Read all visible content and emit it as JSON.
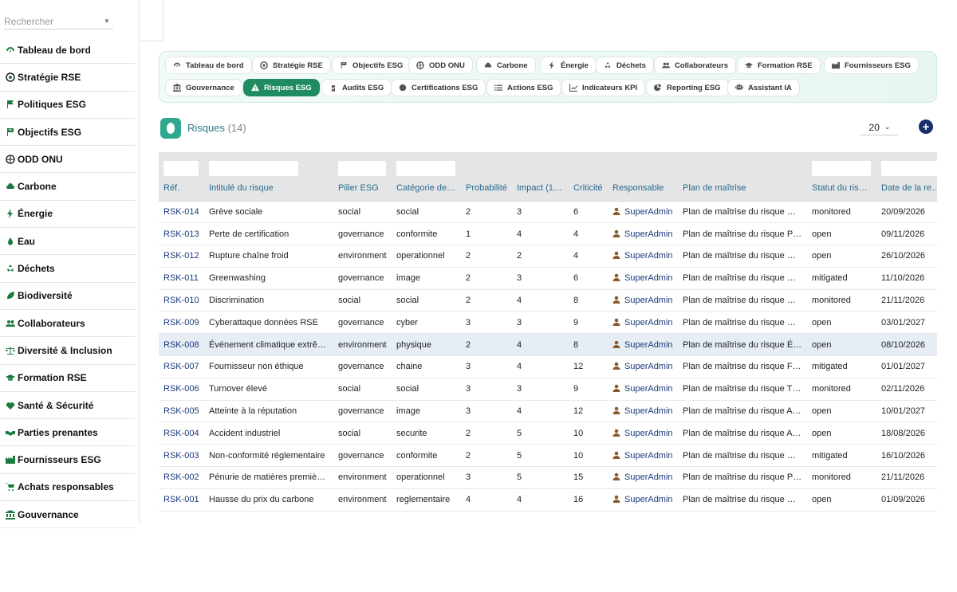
{
  "search": {
    "placeholder": "Rechercher"
  },
  "sidebar": {
    "items": [
      {
        "label": "Tableau de bord",
        "icon": "dashboard-icon"
      },
      {
        "label": "Stratégie RSE",
        "icon": "target-icon"
      },
      {
        "label": "Politiques ESG",
        "icon": "flag-icon"
      },
      {
        "label": "Objectifs ESG",
        "icon": "flag-checkered-icon"
      },
      {
        "label": "ODD ONU",
        "icon": "globe-icon"
      },
      {
        "label": "Carbone",
        "icon": "cloud-icon"
      },
      {
        "label": "Énergie",
        "icon": "bolt-icon"
      },
      {
        "label": "Eau",
        "icon": "water-drop-icon"
      },
      {
        "label": "Déchets",
        "icon": "recycle-icon"
      },
      {
        "label": "Biodiversité",
        "icon": "leaf-icon"
      },
      {
        "label": "Collaborateurs",
        "icon": "users-icon"
      },
      {
        "label": "Diversité & Inclusion",
        "icon": "balance-icon"
      },
      {
        "label": "Formation RSE",
        "icon": "graduation-cap-icon"
      },
      {
        "label": "Santé & Sécurité",
        "icon": "heart-pulse-icon"
      },
      {
        "label": "Parties prenantes",
        "icon": "handshake-icon"
      },
      {
        "label": "Fournisseurs ESG",
        "icon": "industry-icon"
      },
      {
        "label": "Achats responsables",
        "icon": "cart-icon"
      },
      {
        "label": "Gouvernance",
        "icon": "landmark-icon"
      }
    ]
  },
  "tabs": {
    "row1": [
      {
        "label": "Tableau de bord",
        "icon": "dashboard-icon"
      },
      {
        "label": "Stratégie RSE",
        "icon": "target-icon"
      },
      {
        "label": "Objectifs ESG",
        "icon": "flag-checkered-icon"
      },
      {
        "label": "ODD ONU",
        "icon": "globe-icon"
      },
      {
        "label": "Carbone",
        "icon": "cloud-icon"
      },
      {
        "label": "Énergie",
        "icon": "bolt-icon"
      },
      {
        "label": "Déchets",
        "icon": "recycle-icon"
      },
      {
        "label": "Collaborateurs",
        "icon": "users-icon"
      },
      {
        "label": "Formation RSE",
        "icon": "graduation-cap-icon"
      },
      {
        "label": "Fournisseurs ESG",
        "icon": "industry-icon"
      }
    ],
    "row2": [
      {
        "label": "Gouvernance",
        "icon": "landmark-icon"
      },
      {
        "label": "Risques ESG",
        "icon": "warning-icon",
        "active": true
      },
      {
        "label": "Audits ESG",
        "icon": "clipboard-check-icon"
      },
      {
        "label": "Certifications ESG",
        "icon": "certificate-icon"
      },
      {
        "label": "Actions ESG",
        "icon": "list-icon"
      },
      {
        "label": "Indicateurs KPI",
        "icon": "chart-line-icon"
      },
      {
        "label": "Reporting ESG",
        "icon": "chart-pie-icon"
      },
      {
        "label": "Assistant IA",
        "icon": "robot-icon"
      }
    ]
  },
  "list": {
    "title": "Risques",
    "count": "(14)",
    "page_size": "20",
    "add_label": "+"
  },
  "table": {
    "columns": [
      "Réf.",
      "Intitulé du risque",
      "Pilier ESG",
      "Catégorie de…",
      "Probabilité",
      "Impact (1-5)",
      "Criticité",
      "Responsable",
      "Plan de maîtrise",
      "Statut du ris…",
      "Date de la re…"
    ],
    "rows": [
      [
        "RSK-014",
        "Grève sociale",
        "social",
        "social",
        "2",
        "3",
        "6",
        "SuperAdmin",
        "Plan de maîtrise du risque …",
        "monitored",
        "20/09/2026"
      ],
      [
        "RSK-013",
        "Perte de certification",
        "governance",
        "conformite",
        "1",
        "4",
        "4",
        "SuperAdmin",
        "Plan de maîtrise du risque P…",
        "open",
        "09/11/2026"
      ],
      [
        "RSK-012",
        "Rupture chaîne froid",
        "environment",
        "operationnel",
        "2",
        "2",
        "4",
        "SuperAdmin",
        "Plan de maîtrise du risque …",
        "open",
        "26/10/2026"
      ],
      [
        "RSK-011",
        "Greenwashing",
        "governance",
        "image",
        "2",
        "3",
        "6",
        "SuperAdmin",
        "Plan de maîtrise du risque …",
        "mitigated",
        "11/10/2026"
      ],
      [
        "RSK-010",
        "Discrimination",
        "social",
        "social",
        "2",
        "4",
        "8",
        "SuperAdmin",
        "Plan de maîtrise du risque …",
        "monitored",
        "21/11/2026"
      ],
      [
        "RSK-009",
        "Cyberattaque données RSE",
        "governance",
        "cyber",
        "3",
        "3",
        "9",
        "SuperAdmin",
        "Plan de maîtrise du risque …",
        "open",
        "03/01/2027"
      ],
      [
        "RSK-008",
        "Événement climatique extrê…",
        "environment",
        "physique",
        "2",
        "4",
        "8",
        "SuperAdmin",
        "Plan de maîtrise du risque É…",
        "open",
        "08/10/2026"
      ],
      [
        "RSK-007",
        "Fournisseur non éthique",
        "governance",
        "chaine",
        "3",
        "4",
        "12",
        "SuperAdmin",
        "Plan de maîtrise du risque F…",
        "mitigated",
        "01/01/2027"
      ],
      [
        "RSK-006",
        "Turnover élevé",
        "social",
        "social",
        "3",
        "3",
        "9",
        "SuperAdmin",
        "Plan de maîtrise du risque T…",
        "monitored",
        "02/11/2026"
      ],
      [
        "RSK-005",
        "Atteinte à la réputation",
        "governance",
        "image",
        "3",
        "4",
        "12",
        "SuperAdmin",
        "Plan de maîtrise du risque A…",
        "open",
        "10/01/2027"
      ],
      [
        "RSK-004",
        "Accident industriel",
        "social",
        "securite",
        "2",
        "5",
        "10",
        "SuperAdmin",
        "Plan de maîtrise du risque A…",
        "open",
        "18/08/2026"
      ],
      [
        "RSK-003",
        "Non-conformité réglementaire",
        "governance",
        "conformite",
        "2",
        "5",
        "10",
        "SuperAdmin",
        "Plan de maîtrise du risque …",
        "mitigated",
        "16/10/2026"
      ],
      [
        "RSK-002",
        "Pénurie de matières premiè…",
        "environment",
        "operationnel",
        "3",
        "5",
        "15",
        "SuperAdmin",
        "Plan de maîtrise du risque P…",
        "monitored",
        "21/11/2026"
      ],
      [
        "RSK-001",
        "Hausse du prix du carbone",
        "environment",
        "reglementaire",
        "4",
        "4",
        "16",
        "SuperAdmin",
        "Plan de maîtrise du risque …",
        "open",
        "01/09/2026"
      ]
    ],
    "highlighted_row": 6
  },
  "colors": {
    "accent_green": "#1f8c5f",
    "link_blue": "#1a3a7a",
    "header_text": "#2a6a8c",
    "add_button": "#1a2e6b"
  }
}
